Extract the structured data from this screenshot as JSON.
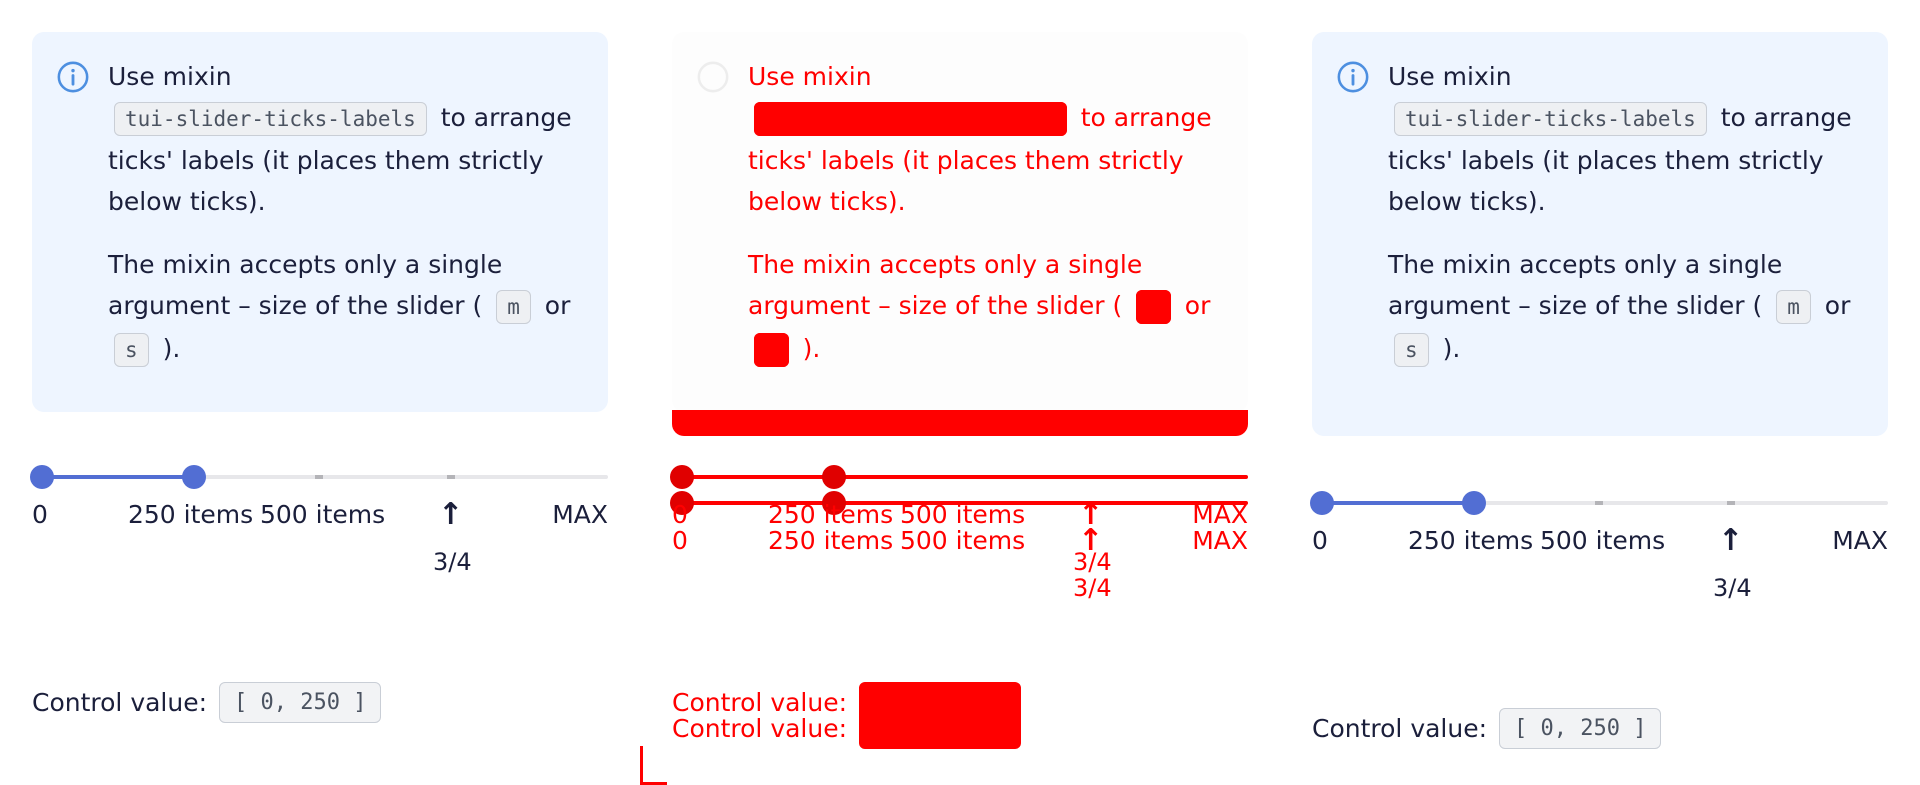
{
  "note": {
    "p1_before": "Use mixin",
    "p1_code": "tui-slider-ticks-labels",
    "p1_after": "to arrange ticks' labels (it places them strictly below ticks).",
    "p2_before": "The mixin accepts only a single argument – size of the slider (",
    "p2_code_m": "m",
    "p2_or": "or",
    "p2_code_s": "s",
    "p2_after": ")."
  },
  "slider": {
    "range_value": [
      0,
      250
    ],
    "max": 1000,
    "tick_labels": [
      "0",
      "250 items",
      "500 items",
      "MAX"
    ],
    "arrow_label": "3/4"
  },
  "control": {
    "label": "Control value:",
    "value": "[ 0, 250 ]"
  },
  "colors": {
    "accent": "#526ed3",
    "note_bg": "#eef5ff",
    "diff_red": "#ff0000"
  },
  "icons": [
    "info-icon",
    "arrow-up-icon"
  ]
}
